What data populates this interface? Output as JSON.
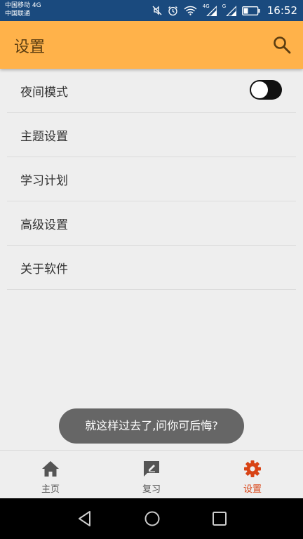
{
  "status_bar": {
    "carrier_1": "中国移动 4G",
    "carrier_2": "中国联通",
    "signal_1_label": "4G",
    "signal_2_label": "G",
    "time": "16:52",
    "icons": [
      "mute-icon",
      "alarm-icon",
      "wifi-icon",
      "signal-icon",
      "signal-icon",
      "battery-icon"
    ]
  },
  "app_bar": {
    "title": "设置",
    "search_icon": "search-icon"
  },
  "settings": {
    "items": [
      {
        "label": "夜间模式",
        "toggle": true,
        "toggle_on": false
      },
      {
        "label": "主题设置"
      },
      {
        "label": "学习计划"
      },
      {
        "label": "高级设置"
      },
      {
        "label": "关于软件"
      }
    ]
  },
  "toast": {
    "text": "就这样过去了,问你可后悔?"
  },
  "bottom_nav": {
    "items": [
      {
        "label": "主页",
        "icon": "home-icon",
        "active": false
      },
      {
        "label": "复习",
        "icon": "review-icon",
        "active": false
      },
      {
        "label": "设置",
        "icon": "gear-icon",
        "active": true
      }
    ]
  },
  "colors": {
    "status_bar": "#1a4a7e",
    "app_bar": "#ffb24a",
    "active": "#d84315",
    "background": "#eeeeee"
  }
}
